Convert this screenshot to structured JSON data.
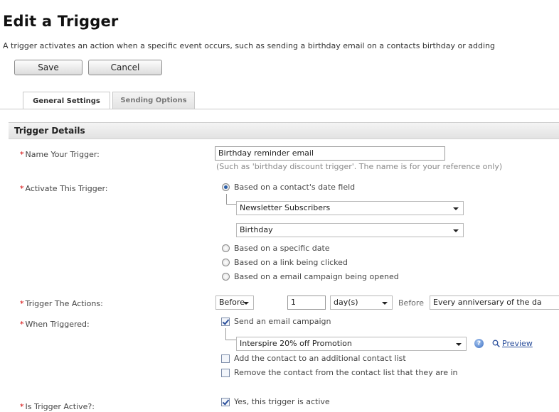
{
  "page": {
    "title": "Edit a Trigger",
    "intro": "A trigger activates an action when a specific event occurs, such as sending a birthday email on a contacts birthday or adding"
  },
  "toolbar": {
    "save_label": "Save",
    "cancel_label": "Cancel"
  },
  "tabs": [
    {
      "label": "General Settings",
      "active": true
    },
    {
      "label": "Sending Options",
      "active": false
    }
  ],
  "section": {
    "title": "Trigger Details"
  },
  "fields": {
    "name": {
      "label": "Name Your Trigger:",
      "value": "Birthday reminder email",
      "hint": "(Such as 'birthday discount trigger'. The name is for your reference only)"
    },
    "activate": {
      "label": "Activate This Trigger:",
      "options": [
        "Based on a contact's date field",
        "Based on a specific date",
        "Based on a link being clicked",
        "Based on a email campaign being opened"
      ],
      "selected_index": 0,
      "list_select": "Newsletter Subscribers",
      "field_select": "Birthday"
    },
    "actions": {
      "label": "Trigger The Actions:",
      "timing_select": "Before",
      "amount": "1",
      "unit_select": "day(s)",
      "before_text": "Before",
      "anniversary_select": "Every anniversary of the da"
    },
    "when": {
      "label": "When Triggered:",
      "send_campaign": "Send an email campaign",
      "campaign_select": "Interspire 20% off Promotion",
      "preview_label": "Preview",
      "add_contact": "Add the contact to an additional contact list",
      "remove_contact": "Remove the contact from the contact list that they are in"
    },
    "active": {
      "label": "Is Trigger Active?:",
      "option": "Yes, this trigger is active"
    }
  },
  "required_marker": "*",
  "colors": {
    "required": "#d40000",
    "link": "#2b4f9c",
    "radio_selected": "#2a5ea8"
  },
  "icons": {
    "info": "info-circle-icon",
    "preview": "magnifier-icon"
  }
}
